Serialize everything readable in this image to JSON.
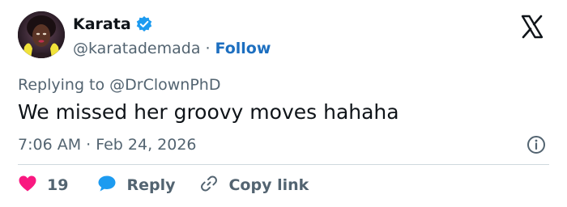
{
  "author": {
    "display_name": "Karata",
    "handle": "@karatademada",
    "separator": "·",
    "follow_label": "Follow",
    "verified": true
  },
  "reply_context": {
    "text": "Replying to @DrClownPhD"
  },
  "tweet": {
    "text": "We missed her groovy moves hahaha",
    "timestamp": "7:06 AM · Feb 24, 2026"
  },
  "actions": {
    "like_count": "19",
    "reply_label": "Reply",
    "copy_label": "Copy link"
  },
  "icons": {
    "logo": "x-logo-icon",
    "verified": "verified-badge-icon",
    "info": "info-icon",
    "like": "heart-icon",
    "reply": "speech-bubble-icon",
    "copy": "link-icon"
  },
  "colors": {
    "accent": "#1d9bf0",
    "follow": "#1d6fc0",
    "heart": "#f91880",
    "muted": "#536471",
    "text": "#0f1419"
  }
}
